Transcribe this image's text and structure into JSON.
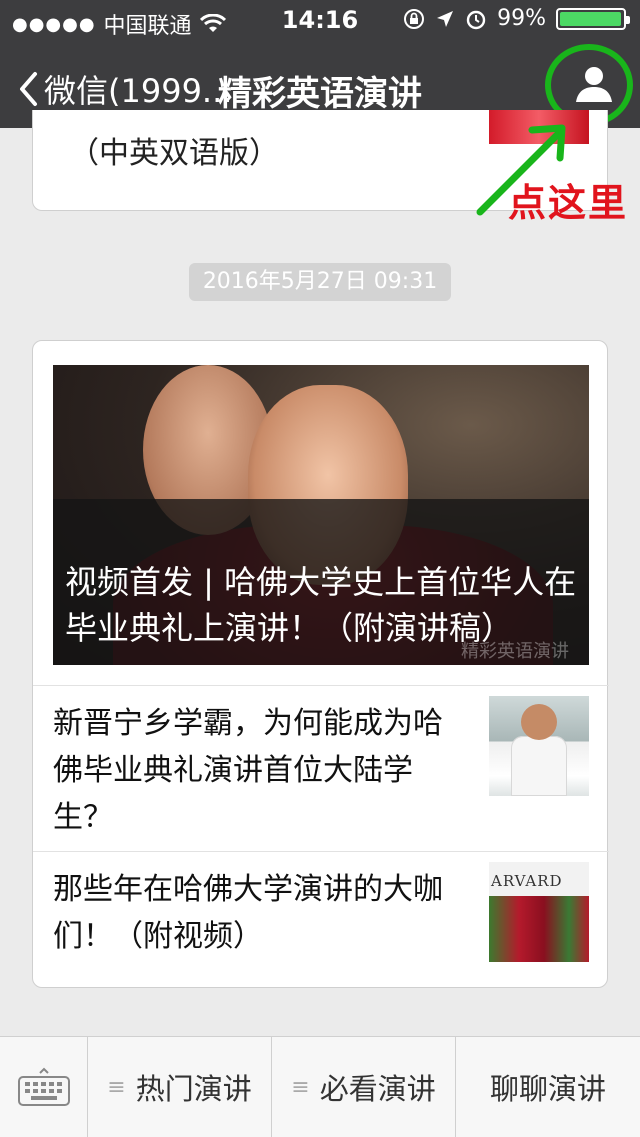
{
  "status": {
    "carrier": "中国联通",
    "signal_dots": "●●●●●",
    "time": "14:16",
    "battery": "99%",
    "battery_level": 0.99
  },
  "nav": {
    "back_label": "微信(1999...",
    "title": "精彩英语演讲"
  },
  "annotation": {
    "text": "点这里",
    "color": "#e1141d",
    "circle_color": "#19b51b"
  },
  "messages": {
    "previous_card_tail": "（中英双语版）",
    "timestamp": "2016年5月27日 09:31",
    "main_article": {
      "title": "视频首发 | 哈佛大学史上首位华人在毕业典礼上演讲！（附演讲稿）",
      "watermark": "精彩英语演讲"
    },
    "articles": [
      {
        "title": "新晋宁乡学霸，为何能成为哈佛毕业典礼演讲首位大陆学生？"
      },
      {
        "title": "那些年在哈佛大学演讲的大咖们！（附视频）",
        "thumb_text": "ARVARD"
      }
    ]
  },
  "bottom_menu": {
    "items": [
      {
        "label": "热门演讲",
        "has_submenu": true
      },
      {
        "label": "必看演讲",
        "has_submenu": true
      },
      {
        "label": "聊聊演讲",
        "has_submenu": false
      }
    ]
  },
  "colors": {
    "navbar_bg": "#3d3d3f",
    "chat_bg": "#ebebeb",
    "battery_fill": "#4cd964"
  }
}
